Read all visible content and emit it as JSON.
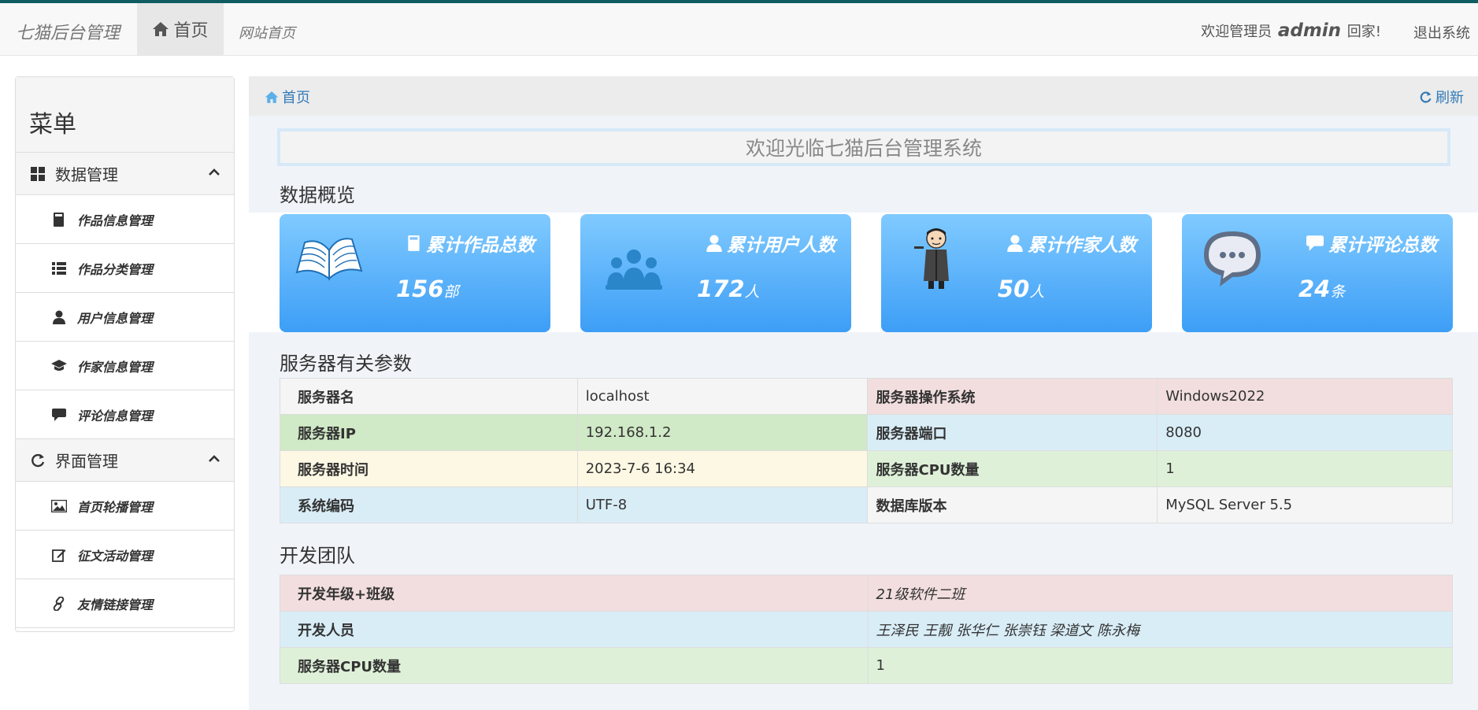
{
  "colors": {
    "topline": "#0f5d63",
    "card_gradient_top": "#80caff",
    "card_gradient_bottom": "#3d9ef6",
    "link": "#337ab7"
  },
  "navbar": {
    "brand": "七猫后台管理",
    "home": "首页",
    "site_home": "网站首页",
    "welcome_prefix": "欢迎管理员",
    "admin_name": "admin",
    "welcome_suffix": "回家!",
    "logout": "退出系统"
  },
  "sidebar": {
    "title": "菜单",
    "groups": [
      {
        "label": "数据管理",
        "icon": "grid-icon",
        "items": [
          {
            "label": "作品信息管理",
            "icon": "book-icon"
          },
          {
            "label": "作品分类管理",
            "icon": "list-icon"
          },
          {
            "label": "用户信息管理",
            "icon": "user-icon"
          },
          {
            "label": "作家信息管理",
            "icon": "graduation-cap-icon"
          },
          {
            "label": "评论信息管理",
            "icon": "comment-icon"
          }
        ]
      },
      {
        "label": "界面管理",
        "icon": "refresh-icon",
        "items": [
          {
            "label": "首页轮播管理",
            "icon": "picture-icon"
          },
          {
            "label": "征文活动管理",
            "icon": "edit-icon"
          },
          {
            "label": "友情链接管理",
            "icon": "link-icon"
          }
        ]
      }
    ]
  },
  "breadcrumb": {
    "home": "首页",
    "refresh": "刷新"
  },
  "welcome_banner": "欢迎光临七猫后台管理系统",
  "overview": {
    "title": "数据概览",
    "cards": [
      {
        "label": "累计作品总数",
        "value": "156",
        "unit": "部",
        "icon": "book-icon"
      },
      {
        "label": "累计用户人数",
        "value": "172",
        "unit": "人",
        "icon": "user-icon"
      },
      {
        "label": "累计作家人数",
        "value": "50",
        "unit": "人",
        "icon": "user-icon"
      },
      {
        "label": "累计评论总数",
        "value": "24",
        "unit": "条",
        "icon": "comment-icon"
      }
    ]
  },
  "server": {
    "title": "服务器有关参数",
    "rows": [
      {
        "k1": "服务器名",
        "v1": "localhost",
        "k2": "服务器操作系统",
        "v2": "Windows2022"
      },
      {
        "k1": "服务器IP",
        "v1": "192.168.1.2",
        "k2": "服务器端口",
        "v2": "8080"
      },
      {
        "k1": "服务器时间",
        "v1": "2023-7-6 16:34",
        "k2": "服务器CPU数量",
        "v2": "1"
      },
      {
        "k1": "系统编码",
        "v1": "UTF-8",
        "k2": "数据库版本",
        "v2": "MySQL Server 5.5"
      }
    ]
  },
  "team": {
    "title": "开发团队",
    "rows": [
      {
        "k": "开发年级+班级",
        "v": "21级软件二班"
      },
      {
        "k": "开发人员",
        "v": "王泽民 王靓 张华仁 张崇钰 梁道文 陈永梅"
      },
      {
        "k": "服务器CPU数量",
        "v": "1"
      }
    ]
  }
}
